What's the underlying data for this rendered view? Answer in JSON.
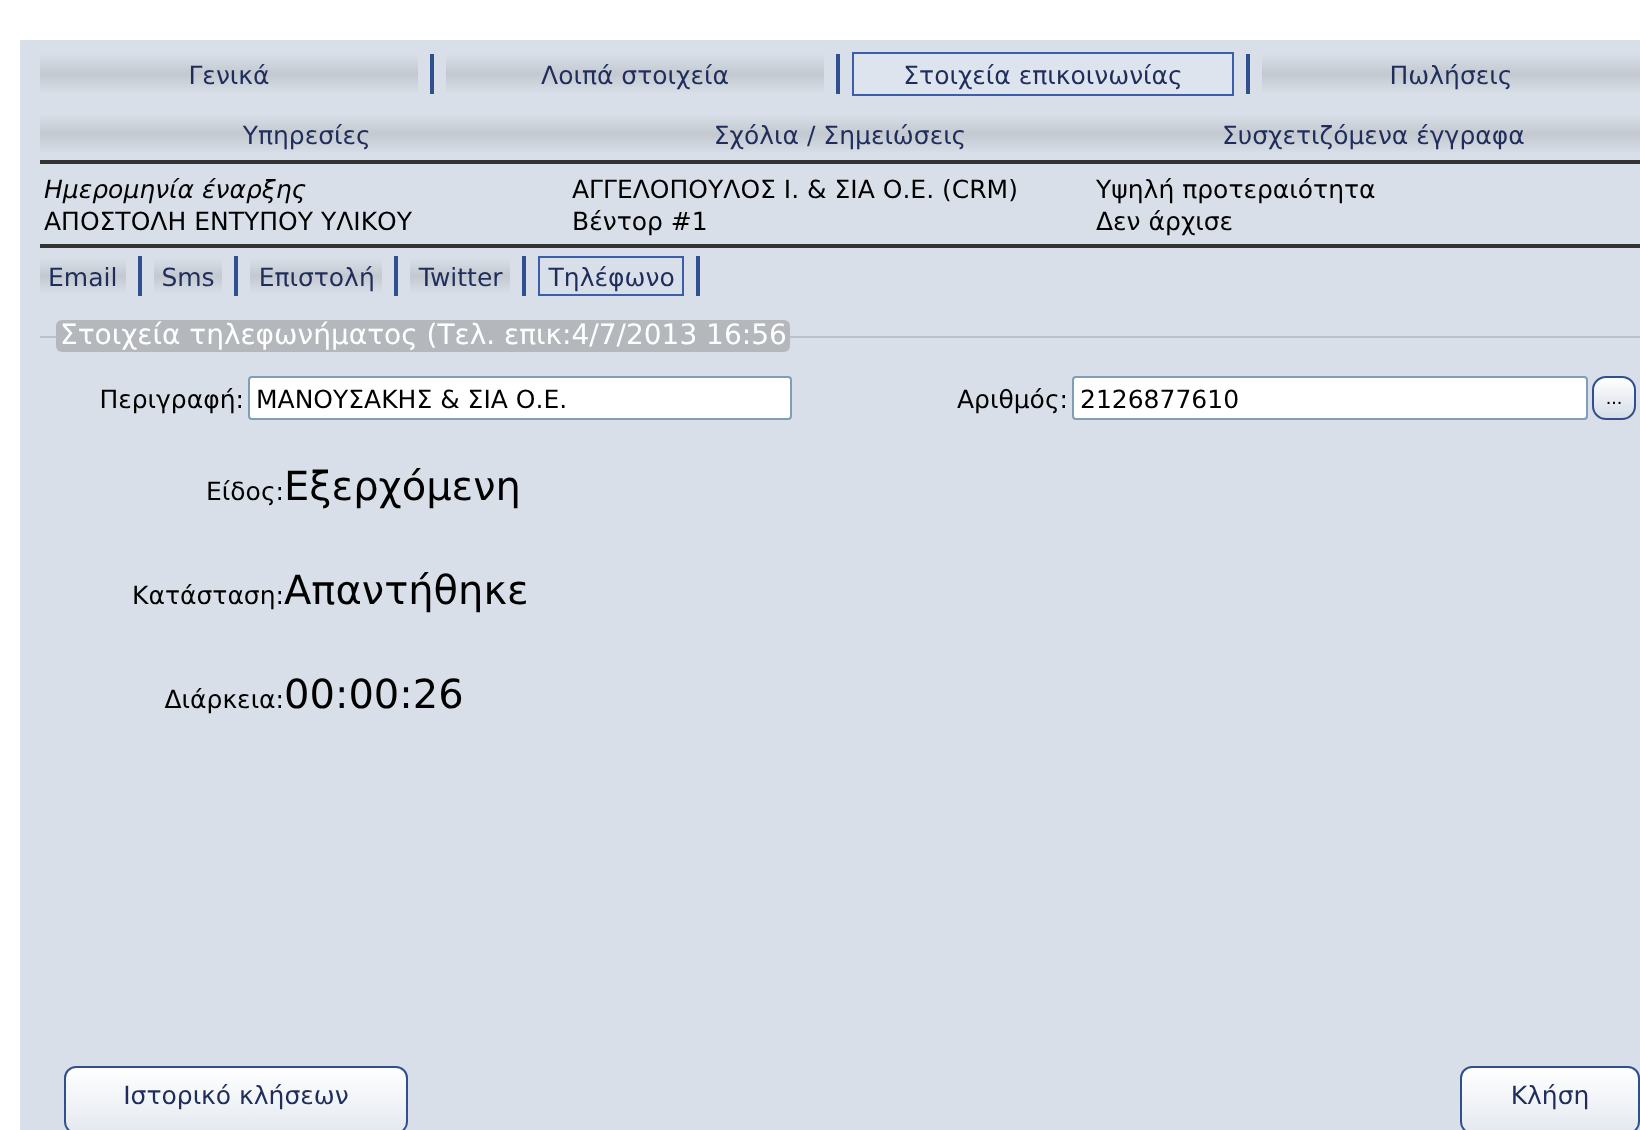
{
  "main_tabs": [
    [
      {
        "label": "Γενικά",
        "selected": false
      },
      {
        "label": "Λοιπά στοιχεία",
        "selected": false
      },
      {
        "label": "Στοιχεία επικοινωνίας",
        "selected": true
      },
      {
        "label": "Πωλήσεις",
        "selected": false
      }
    ],
    [
      {
        "label": "Υπηρεσίες",
        "selected": false
      },
      {
        "label": "Σχόλια / Σημειώσεις",
        "selected": false
      },
      {
        "label": "Συσχετιζόμενα έγγραφα",
        "selected": false
      }
    ]
  ],
  "summary": {
    "start_date_label": "Ημερομηνία έναρξης",
    "subject": "ΑΠΟΣΤΟΛΗ ΕΝΤΥΠΟΥ ΥΛΙΚΟΥ",
    "company": "ΑΓΓΕΛΟΠΟΥΛΟΣ Ι. & ΣΙΑ Ο.Ε. (CRM)",
    "vendor": "Βέντορ #1",
    "priority": "Υψηλή προτεραιότητα",
    "status": "Δεν άρχισε"
  },
  "channel_tabs": [
    {
      "label": "Email",
      "selected": false
    },
    {
      "label": "Sms",
      "selected": false
    },
    {
      "label": "Επιστολή",
      "selected": false
    },
    {
      "label": "Twitter",
      "selected": false
    },
    {
      "label": "Τηλέφωνο",
      "selected": true
    }
  ],
  "group_title": "Στοιχεία τηλεφωνήματος (Τελ. επικ:4/7/2013 16:56",
  "description": {
    "label": "Περιγραφή:",
    "value": "ΜΑΝΟΥΣΑΚΗΣ & ΣΙΑ Ο.Ε."
  },
  "number": {
    "label": "Αριθμός:",
    "value": "2126877610",
    "button": "..."
  },
  "details": [
    {
      "label": "Είδος:",
      "value": "Εξερχόμενη"
    },
    {
      "label": "Κατάσταση:",
      "value": "Απαντήθηκε"
    },
    {
      "label": "Διάρκεια:",
      "value": "00:00:26"
    }
  ],
  "buttons": [
    "Ιστορικό κλήσεων",
    "Κλήση"
  ]
}
